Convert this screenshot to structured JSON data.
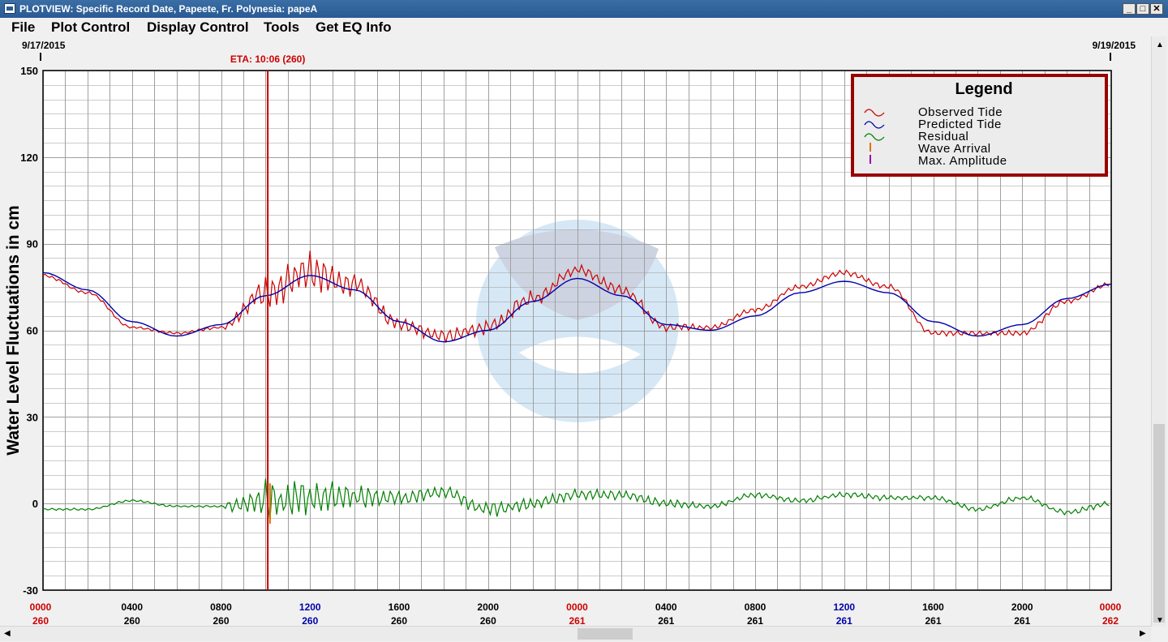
{
  "window": {
    "title": "PLOTVIEW: Specific Record Date, Papeete, Fr. Polynesia: papeA",
    "minimize_glyph": "_",
    "maximize_glyph": "□",
    "close_glyph": "✕"
  },
  "menu": [
    "File",
    "Plot Control",
    "Display Control",
    "Tools",
    "Get EQ Info"
  ],
  "colors": {
    "observed": "#cc0000",
    "predicted": "#0000aa",
    "residual": "#008000",
    "wave_arrival": "#e07000",
    "max_amplitude": "#9900aa",
    "eta_line": "#cc0000",
    "legend_border": "#990000",
    "grid": "#a0a0a0",
    "day_start_label": "#cc0000",
    "noon_label": "#0000aa"
  },
  "chart_data": {
    "type": "line",
    "ylabel": "Water Level Fluctuations in cm",
    "ylim": [
      -30,
      150
    ],
    "yticks": [
      150,
      120,
      90,
      60,
      30,
      0,
      -30
    ],
    "x_unit": "hours",
    "xlim": [
      0,
      48
    ],
    "date_start": "9/17/2015",
    "date_end": "9/19/2015",
    "xticks": [
      {
        "x": 0,
        "time": "0000",
        "day": "260"
      },
      {
        "x": 4,
        "time": "0400",
        "day": "260"
      },
      {
        "x": 8,
        "time": "0800",
        "day": "260"
      },
      {
        "x": 12,
        "time": "1200",
        "day": "260"
      },
      {
        "x": 16,
        "time": "1600",
        "day": "260"
      },
      {
        "x": 20,
        "time": "2000",
        "day": "260"
      },
      {
        "x": 24,
        "time": "0000",
        "day": "261"
      },
      {
        "x": 28,
        "time": "0400",
        "day": "261"
      },
      {
        "x": 32,
        "time": "0800",
        "day": "261"
      },
      {
        "x": 36,
        "time": "1200",
        "day": "261"
      },
      {
        "x": 40,
        "time": "1600",
        "day": "261"
      },
      {
        "x": 44,
        "time": "2000",
        "day": "261"
      },
      {
        "x": 48,
        "time": "0000",
        "day": "262"
      }
    ],
    "eta": {
      "x": 10.1,
      "label": "ETA: 10:06 (260)"
    },
    "wave_arrival_x": 10.2,
    "legend": {
      "title": "Legend",
      "placement": "top-right",
      "entries": [
        "Observed Tide",
        "Predicted Tide",
        "Residual",
        "Wave Arrival",
        "Max. Amplitude"
      ]
    },
    "series": [
      {
        "name": "Predicted Tide",
        "x": [
          0,
          2,
          4,
          6,
          8,
          10,
          12,
          14,
          16,
          18,
          20,
          22,
          24,
          26,
          28,
          30,
          32,
          34,
          36,
          38,
          40,
          42,
          44,
          46,
          48
        ],
        "values": [
          80,
          74,
          63,
          58,
          62,
          72,
          79,
          74,
          63,
          56,
          60,
          70,
          78,
          72,
          62,
          60,
          65,
          73,
          77,
          73,
          63,
          58,
          62,
          71,
          76
        ]
      },
      {
        "name": "Observed Tide",
        "x": [
          0,
          2,
          4,
          6,
          8,
          10,
          12,
          14,
          16,
          18,
          20,
          22,
          24,
          26,
          28,
          30,
          32,
          34,
          36,
          38,
          40,
          42,
          44,
          46,
          48
        ],
        "values": [
          79,
          73,
          61,
          59,
          61,
          73,
          80,
          76,
          62,
          58,
          61,
          71,
          81,
          74,
          61,
          61,
          67,
          75,
          80,
          75,
          59,
          59,
          59,
          70,
          76
        ],
        "noise_amplitude": [
          0.5,
          0.5,
          0.5,
          0.5,
          0.5,
          6,
          7,
          4,
          3,
          3,
          3,
          3,
          2,
          2,
          2,
          1,
          1,
          1,
          1,
          1,
          1,
          1,
          1,
          1,
          1
        ]
      },
      {
        "name": "Residual",
        "x": [
          0,
          2,
          4,
          6,
          8,
          10,
          12,
          14,
          16,
          18,
          20,
          22,
          24,
          26,
          28,
          30,
          32,
          34,
          36,
          38,
          40,
          42,
          44,
          46,
          48
        ],
        "values": [
          -2,
          -2,
          1,
          -1,
          -1,
          1,
          2,
          2,
          2,
          4,
          -2,
          0,
          3,
          3,
          0,
          -1,
          3,
          1,
          3,
          2,
          2,
          -2,
          2,
          -3,
          0
        ],
        "noise_amplitude": [
          0.4,
          0.4,
          0.4,
          0.4,
          0.4,
          7,
          7,
          4,
          3,
          2,
          3,
          2,
          2,
          2,
          1.5,
          1,
          1,
          1,
          1,
          1,
          1,
          1,
          1,
          1,
          1
        ]
      }
    ]
  }
}
